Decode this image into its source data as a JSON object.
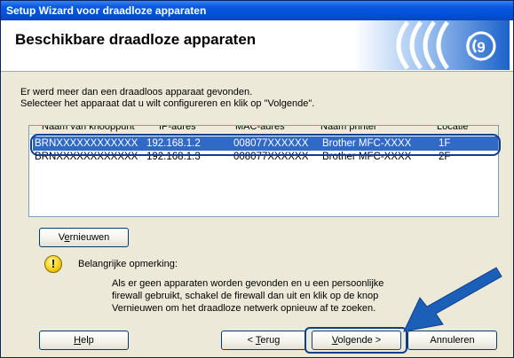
{
  "window": {
    "title": "Setup Wizard voor draadloze apparaten"
  },
  "header": {
    "title": "Beschikbare draadloze apparaten"
  },
  "intro": {
    "line1": "Er werd meer dan een draadloos apparaat gevonden.",
    "line2": "Selecteer het apparaat dat u wilt configureren en klik op \"Volgende\"."
  },
  "device_list": {
    "columns": [
      "Naam van knooppunt",
      "IP-adres",
      "MAC-adres",
      "Naam printer",
      "Locatie"
    ],
    "rows": [
      {
        "node": "BRNXXXXXXXXXXXX",
        "ip": "192.168.1.2",
        "mac": "008077XXXXXX",
        "printer": "Brother MFC-XXXX",
        "location": "1F",
        "selected": true
      },
      {
        "node": "BRNXXXXXXXXXXXX",
        "ip": "192.168.1.3",
        "mac": "008077XXXXXX",
        "printer": "Brother MFC-XXXX",
        "location": "2F",
        "selected": false
      }
    ]
  },
  "buttons": {
    "refresh_pre": "V",
    "refresh_acc": "e",
    "refresh_post": "rnieuwen",
    "help_acc": "H",
    "help_post": "elp",
    "back_pre": "< ",
    "back_acc": "T",
    "back_post": "erug",
    "next_acc": "V",
    "next_post": "olgende >",
    "cancel": "Annuleren"
  },
  "note": {
    "title": "Belangrijke opmerking:",
    "line1": "Als er geen apparaten worden gevonden en u een persoonlijke",
    "line2": "firewall gebruikt, schakel de firewall dan uit en klik op de knop",
    "line3": "Vernieuwen om het draadloze netwerk opnieuw af te zoeken."
  },
  "icons": {
    "note": "exclamation-icon",
    "header": "wireless-signal-icon",
    "pointer": "arrow-pointer-icon"
  },
  "colors": {
    "titlebar": "#0050D8",
    "selection": "#316AC5",
    "highlight": "#0E3F8A",
    "arrow": "#1B5FB8"
  }
}
